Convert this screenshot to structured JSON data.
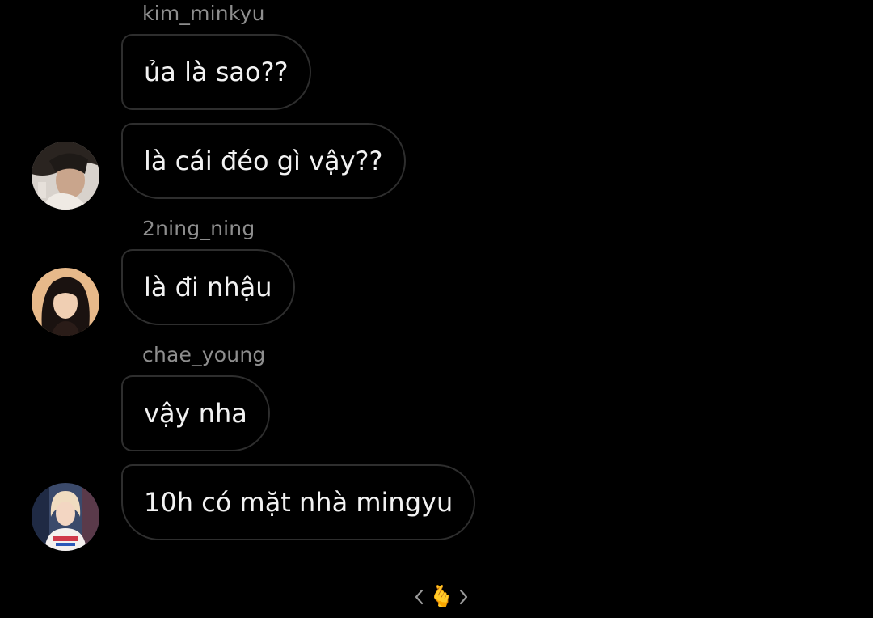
{
  "messages": [
    {
      "sender": "kim_minkyu",
      "text": "ủa là sao??"
    },
    {
      "sender": "",
      "text": "là cái đéo gì vậy??"
    },
    {
      "sender": "2ning_ning",
      "text": "là đi nhậu"
    },
    {
      "sender": "chae_young",
      "text": "vậy nha"
    },
    {
      "sender": "",
      "text": "10h có mặt nhà mingyu"
    }
  ],
  "avatars": [
    "avatar-kim-minkyu",
    "avatar-2ning-ning",
    "avatar-chae-young"
  ],
  "reaction_bar": {
    "emoji": "🫰",
    "prev_icon": "chevron-left-icon",
    "next_icon": "chevron-right-icon"
  },
  "colors": {
    "background": "#000000",
    "bubble_border": "#2e2e2e",
    "message_text": "#f2f2f2",
    "sender_text": "#8e8e8e"
  }
}
